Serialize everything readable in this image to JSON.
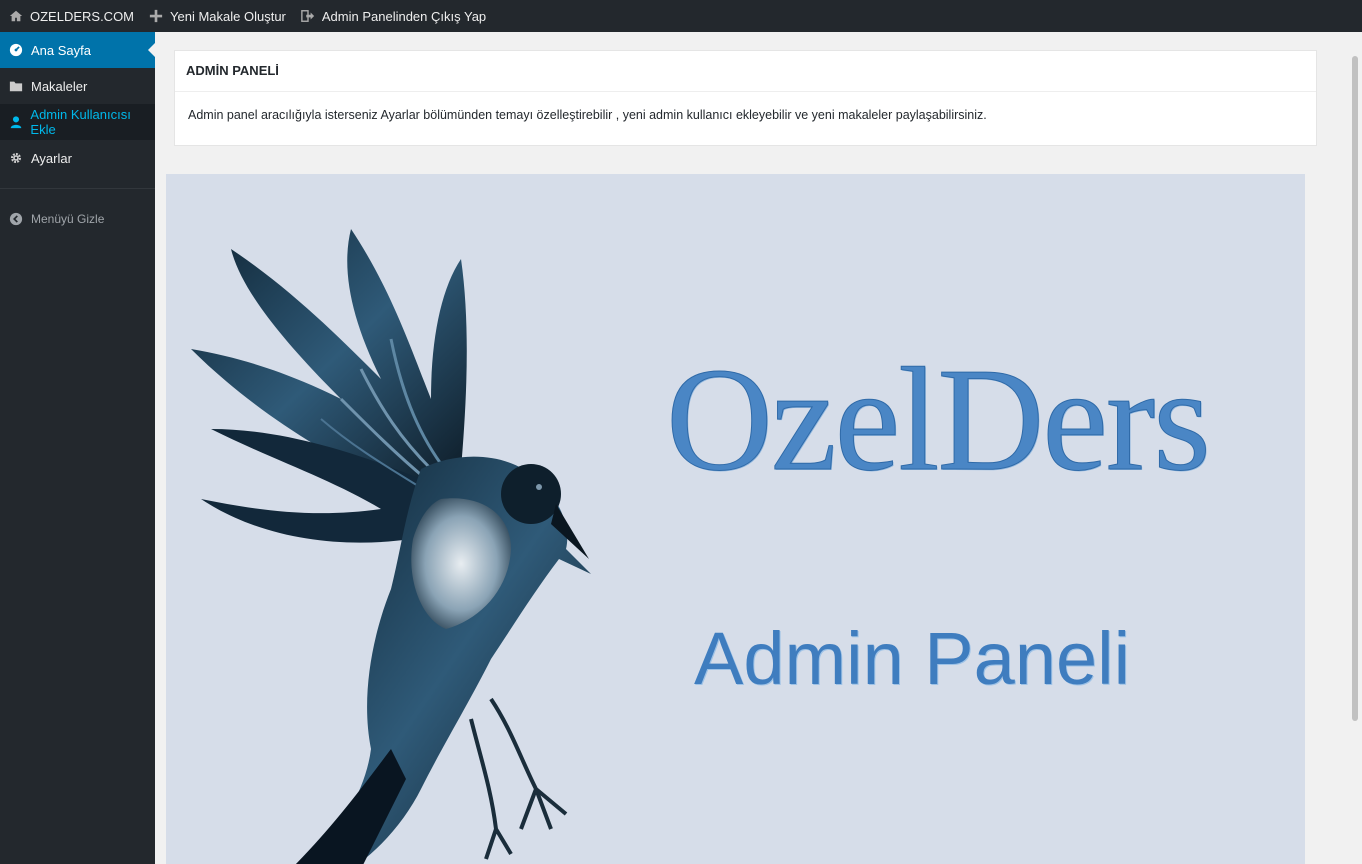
{
  "topbar": {
    "site": "OZELDERS.COM",
    "new_article": "Yeni Makale Oluştur",
    "logout": "Admin Panelinden Çıkış Yap"
  },
  "sidebar": {
    "items": [
      {
        "label": "Ana Sayfa",
        "icon": "dashboard-icon",
        "state": "active"
      },
      {
        "label": "Makaleler",
        "icon": "folder-icon",
        "state": "normal"
      },
      {
        "label": "Admin Kullanıcısı Ekle",
        "icon": "user-icon",
        "state": "hover"
      },
      {
        "label": "Ayarlar",
        "icon": "gear-icon",
        "state": "normal"
      }
    ],
    "collapse_label": "Menüyü Gizle"
  },
  "panel": {
    "title": "ADMİN PANELİ",
    "text": "Admin panel aracılığıyla isterseniz Ayarlar bölümünden temayı özelleştirebilir , yeni admin kullanıcı ekleyebilir ve yeni makaleler paylaşabilirsiniz."
  },
  "banner": {
    "title": "OzelDers",
    "subtitle": "Admin Paneli"
  },
  "colors": {
    "topbar_bg": "#23282d",
    "accent": "#0073aa",
    "hover_text": "#00b9eb",
    "banner_bg": "#d6dde9",
    "banner_text": "#4a86c5"
  }
}
